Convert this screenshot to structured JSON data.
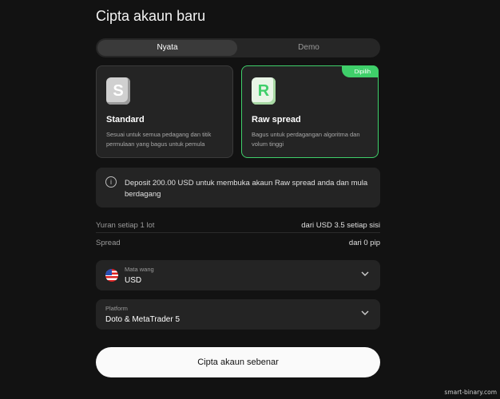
{
  "page": {
    "title": "Cipta akaun baru"
  },
  "tabs": [
    {
      "label": "Nyata",
      "selected": true
    },
    {
      "label": "Demo",
      "selected": false
    }
  ],
  "accounts": {
    "standard": {
      "logo_letter": "S",
      "name": "Standard",
      "description": "Sesuai untuk semua pedagang dan titik permulaan yang bagus untuk pemula"
    },
    "raw": {
      "logo_letter": "R",
      "badge": "Dipilih",
      "name": "Raw spread",
      "description": "Bagus untuk perdagangan algoritma dan volum tinggi"
    }
  },
  "info": {
    "icon": "info-icon",
    "text": "Deposit 200.00 USD untuk membuka akaun Raw spread anda dan mula berdagang"
  },
  "fees": {
    "commission": {
      "label": "Yuran setiap 1 lot",
      "value": "dari USD 3.5 setiap sisi"
    },
    "spread": {
      "label": "Spread",
      "value": "dari 0 pip"
    }
  },
  "currency": {
    "label": "Mata wang",
    "value": "USD",
    "icon": "us-flag-icon"
  },
  "platform": {
    "label": "Platform",
    "value": "Doto & MetaTrader 5"
  },
  "cta": {
    "label": "Cipta akaun sebenar"
  },
  "watermark": "smart-binary.com",
  "colors": {
    "accent": "#3fcf6a",
    "background": "#121212",
    "card": "#242424"
  }
}
